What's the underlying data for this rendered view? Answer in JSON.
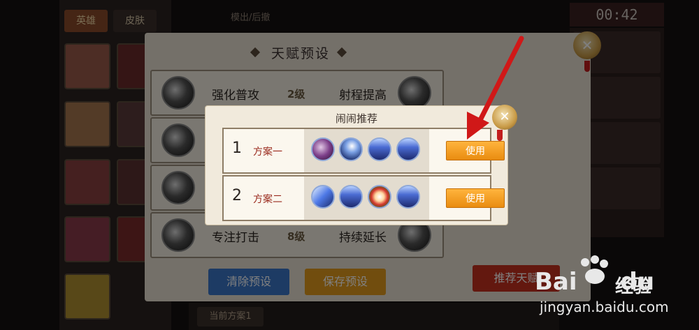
{
  "background": {
    "tabs": {
      "hero": "英雄",
      "skin": "皮肤"
    },
    "top_text": "模出/后撤",
    "timer": "00:42",
    "bottom_btn": "当前方案1"
  },
  "panel": {
    "title": "天赋预设",
    "rows": [
      {
        "left": "强化普攻",
        "level": "2级",
        "right": "射程提高"
      },
      {
        "left": "",
        "level": "",
        "right": ""
      },
      {
        "left": "",
        "level": "",
        "right": ""
      },
      {
        "left": "专注打击",
        "level": "8级",
        "right": "持续延长"
      }
    ],
    "buttons": {
      "clear": "清除预设",
      "save": "保存预设",
      "recommend": "推荐天赋"
    }
  },
  "dialog": {
    "title": "闹闹推荐",
    "plans": [
      {
        "num": "1",
        "name": "方案一",
        "use": "使用",
        "icons": [
          "purple-orb-icon",
          "leaping-blade-icon",
          "mountain-peak-icon",
          "mountain-peak-icon"
        ]
      },
      {
        "num": "2",
        "name": "方案二",
        "use": "使用",
        "icons": [
          "pulse-streak-icon",
          "mountain-peak-icon",
          "flame-ring-icon",
          "mountain-peak-icon"
        ]
      }
    ]
  },
  "watermark": {
    "logo": "Bai",
    "logo2": "du",
    "cn": "经验",
    "url": "jingyan.baidu.com"
  },
  "colors": {
    "use_button": "#f0a020",
    "arrow": "#d01818",
    "clear_button": "#3b76c8",
    "save_button": "#e39a1d",
    "recommend_button": "#c7311f"
  }
}
